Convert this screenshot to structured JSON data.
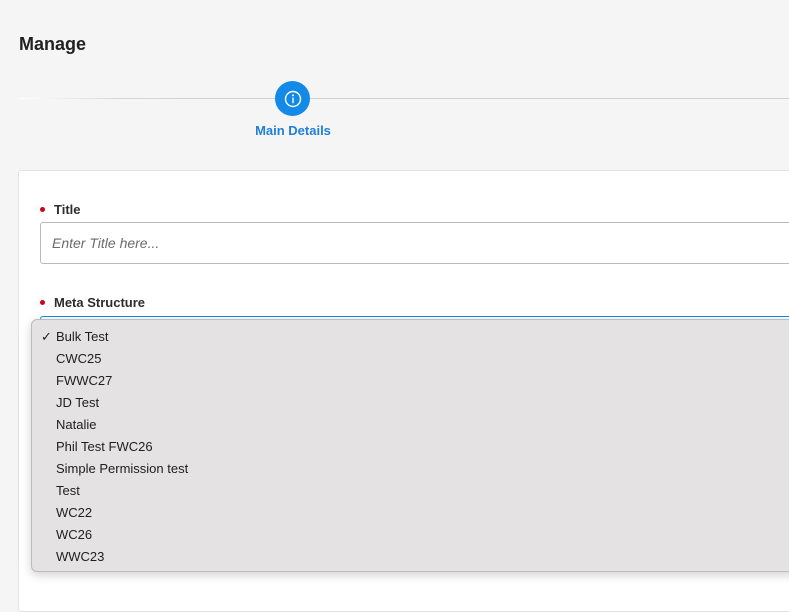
{
  "header": {
    "title": "Manage"
  },
  "stepper": {
    "steps": [
      {
        "label": "Main Details",
        "icon": "info-icon",
        "active": true
      }
    ],
    "accent_color": "#1389e8"
  },
  "form": {
    "title_field": {
      "label": "Title",
      "required": true,
      "value": "",
      "placeholder": "Enter Title here..."
    },
    "meta_structure_field": {
      "label": "Meta Structure",
      "required": true,
      "selected": "Bulk Test",
      "options": [
        "Bulk Test",
        "CWC25",
        "FWWC27",
        "JD Test",
        "Natalie",
        "Phil Test FWC26",
        "Simple Permission test",
        "Test",
        "WC22",
        "WC26",
        "WWC23"
      ]
    }
  },
  "colors": {
    "required_marker": "#d0021b",
    "step_label": "#1e80d8"
  }
}
